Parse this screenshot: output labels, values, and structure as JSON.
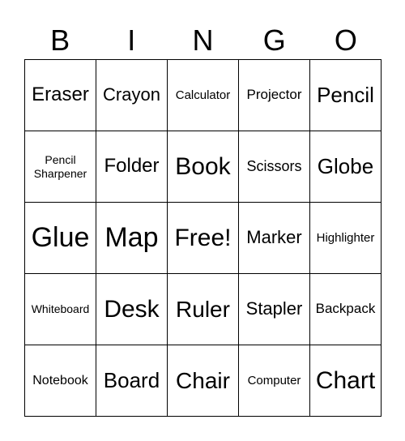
{
  "header": [
    "B",
    "I",
    "N",
    "G",
    "O"
  ],
  "cells": [
    "Eraser",
    "Crayon",
    "Calculator",
    "Projector",
    "Pencil",
    "Pencil Sharpener",
    "Folder",
    "Book",
    "Scissors",
    "Globe",
    "Glue",
    "Map",
    "Free!",
    "Marker",
    "Highlighter",
    "Whiteboard",
    "Desk",
    "Ruler",
    "Stapler",
    "Backpack",
    "Notebook",
    "Board",
    "Chair",
    "Computer",
    "Chart"
  ]
}
